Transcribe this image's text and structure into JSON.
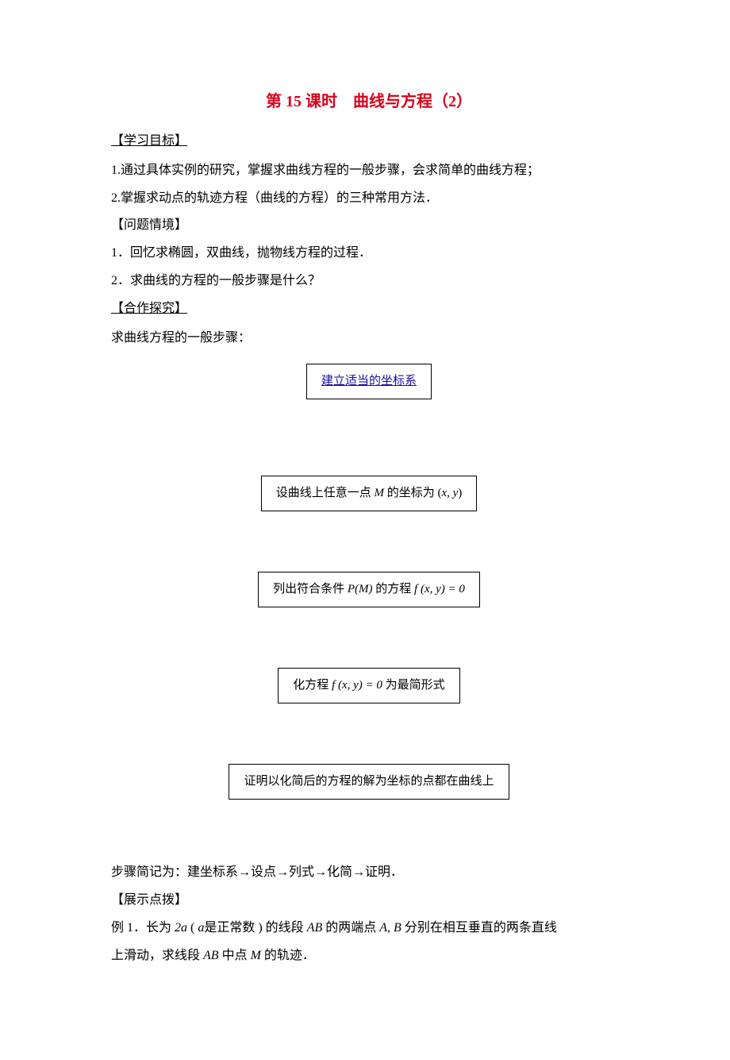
{
  "title": "第 15 课时　曲线与方程（2）",
  "sections": {
    "goals": {
      "heading": "【学习目标】",
      "items": [
        "1.通过具体实例的研究，掌握求曲线方程的一般步骤，会求简单的曲线方程；",
        "2.掌握求动点的轨迹方程（曲线的方程）的三种常用方法．"
      ]
    },
    "context": {
      "heading": "【问题情境】",
      "items": [
        "1．回忆求椭圆，双曲线，抛物线方程的过程．",
        "2．求曲线的方程的一般步骤是什么？"
      ]
    },
    "coop": {
      "heading": "【合作探究】",
      "lead": "求曲线方程的一般步骤："
    },
    "flow": {
      "step1": "建立适当的坐标系",
      "step2_pre": "设曲线上任意一点",
      "step2_mid": "M",
      "step2_post1": " 的坐标为 (",
      "step2_xy": "x, y",
      "step2_post2": ")",
      "step3_pre": "列出符合条件 ",
      "step3_pm": "P(M)",
      "step3_mid": " 的方程 ",
      "step3_fxy": "f (x, y) = 0",
      "step4_pre": "化方程 ",
      "step4_fxy": "f (x, y) = 0",
      "step4_post": " 为最简形式",
      "step5": "证明以化简后的方程的解为坐标的点都在曲线上"
    },
    "summary": "步骤简记为：建坐标系→设点→列式→化简→证明．",
    "show": {
      "heading": "【展示点拨】",
      "ex1_pre": "例 1．长为 ",
      "ex1_2a": "2a",
      "ex1_mid1": " ( ",
      "ex1_a": "a",
      "ex1_mid2": "是正常数 ) 的线段 ",
      "ex1_AB": "AB",
      "ex1_mid3": " 的两端点 ",
      "ex1_A": "A",
      "ex1_comma": ", ",
      "ex1_B": "B",
      "ex1_mid4": " 分别在相互垂直的两条直线",
      "ex1_line2a": "上滑动，求线段 ",
      "ex1_AB2": "AB",
      "ex1_line2b": " 中点 ",
      "ex1_M": "M",
      "ex1_line2c": " 的轨迹．"
    }
  }
}
